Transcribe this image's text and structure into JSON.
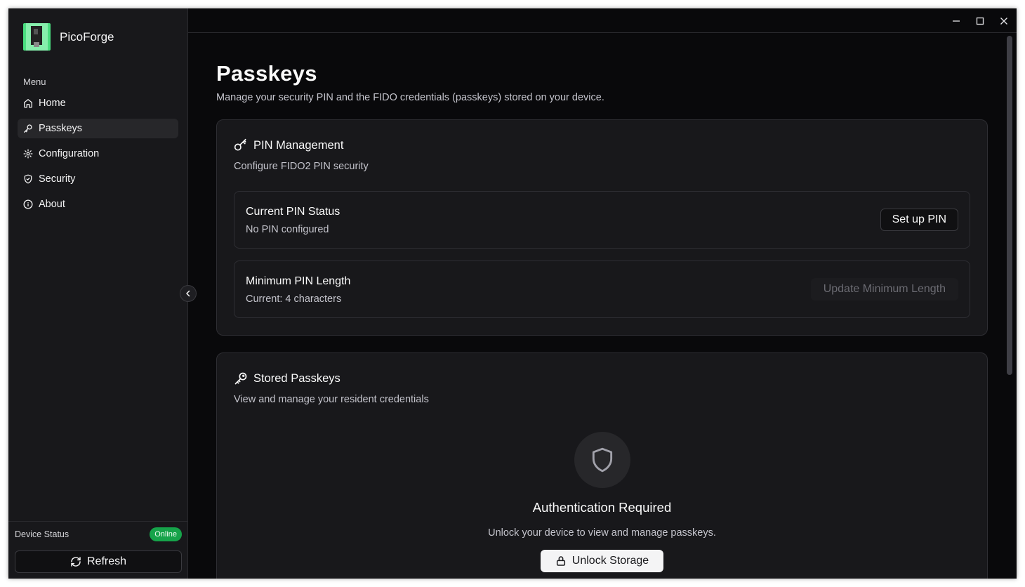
{
  "app": {
    "name": "PicoForge"
  },
  "sidebar": {
    "menu_label": "Menu",
    "items": [
      {
        "label": "Home",
        "icon": "home-icon",
        "active": false
      },
      {
        "label": "Passkeys",
        "icon": "key-icon",
        "active": true
      },
      {
        "label": "Configuration",
        "icon": "gear-icon",
        "active": false
      },
      {
        "label": "Security",
        "icon": "shield-icon",
        "active": false
      },
      {
        "label": "About",
        "icon": "info-icon",
        "active": false
      }
    ],
    "device_status_label": "Device Status",
    "device_status_badge": "Online",
    "refresh_label": "Refresh"
  },
  "page": {
    "title": "Passkeys",
    "subtitle": "Manage your security PIN and the FIDO credentials (passkeys) stored on your device."
  },
  "pin_card": {
    "title": "PIN Management",
    "subtitle": "Configure FIDO2 PIN security",
    "current_status": {
      "title": "Current PIN Status",
      "value": "No PIN configured",
      "button": "Set up PIN"
    },
    "min_length": {
      "title": "Minimum PIN Length",
      "value": "Current: 4 characters",
      "button": "Update Minimum Length"
    }
  },
  "passkeys_card": {
    "title": "Stored Passkeys",
    "subtitle": "View and manage your resident credentials",
    "auth_title": "Authentication Required",
    "auth_subtitle": "Unlock your device to view and manage passkeys.",
    "unlock_button": "Unlock Storage"
  },
  "colors": {
    "background": "#09090b",
    "sidebar": "#18181b",
    "accent_online": "#16a34a",
    "primary_button": "#f4f4f5"
  }
}
